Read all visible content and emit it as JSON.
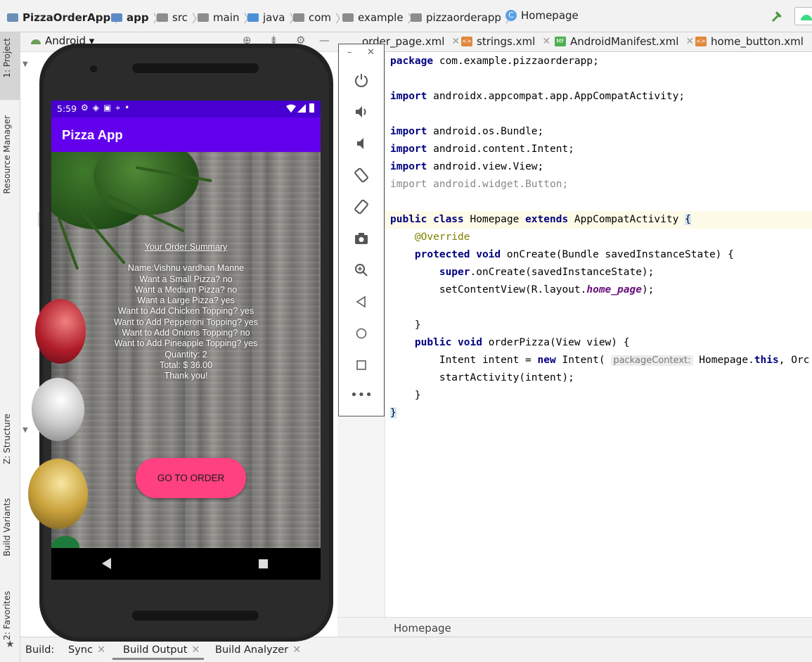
{
  "breadcrumbs": [
    "PizzaOrderApp",
    "app",
    "src",
    "main",
    "java",
    "com",
    "example",
    "pizzaorderapp",
    "Homepage"
  ],
  "project_panel": {
    "view_label": "Android"
  },
  "left_strip": [
    "1: Project",
    "Resource Manager",
    "Z: Structure",
    "Build Variants",
    "2: Favorites"
  ],
  "editor_tabs": [
    "order_page.xml",
    "strings.xml",
    "AndroidManifest.xml",
    "home_button.xml"
  ],
  "code": {
    "package": "com.example.pizzaorderapp;",
    "imp1": "androidx.appcompat.app.AppCompatActivity;",
    "imp2": "android.os.Bundle;",
    "imp3": "android.content.Intent;",
    "imp4": "android.view.View;",
    "imp5": "android.widget.Button;",
    "class_name": "Homepage",
    "super_class": "AppCompatActivity",
    "override": "@Override",
    "oncreate_sig": "onCreate(Bundle savedInstanceState) {",
    "super_call": "onCreate(savedInstanceState);",
    "setcontent_pre": "setContentView(R.layout.",
    "layout_name": "home_page",
    "setcontent_post": ");",
    "orderpizza_sig": "orderPizza(View view) {",
    "intent_decl": "Intent intent = ",
    "intent_ctor": " Intent(",
    "hint": "packageContext:",
    "intent_arg": "Homepage.",
    "intent_tail": ", Orc",
    "start_activity": "startActivity(intent);"
  },
  "editor_breadcrumb": "Homepage",
  "build_bar": {
    "label": "Build:",
    "tabs": [
      "Sync",
      "Build Output",
      "Build Analyzer"
    ]
  },
  "emulator_tools": [
    "power-icon",
    "volume-up-icon",
    "volume-down-icon",
    "rotate-left-icon",
    "rotate-right-icon",
    "camera-icon",
    "zoom-icon",
    "back-icon",
    "home-icon",
    "overview-icon",
    "more-icon"
  ],
  "phone": {
    "time": "5:59",
    "app_title": "Pizza App",
    "summary_title": "Your Order Summary",
    "summary_lines": [
      "Name:Vishnu vardhan Manne",
      "Want a Small Pizza? no",
      "Want a Medium Pizza? no",
      "Want a Large Pizza? yes",
      "Want to Add Chicken Topping? yes",
      "Want to Add Pepperoni Topping? yes",
      "Want to Add Onions Topping? no",
      "Want to Add Pineapple Topping? yes",
      "Quantity: 2",
      "Total: $ 36.00",
      "Thank you!"
    ],
    "order_button": "GO TO ORDER"
  },
  "colors": {
    "app_bar": "#6200ee",
    "status_bar": "#4800d1",
    "button": "#ff4081"
  }
}
